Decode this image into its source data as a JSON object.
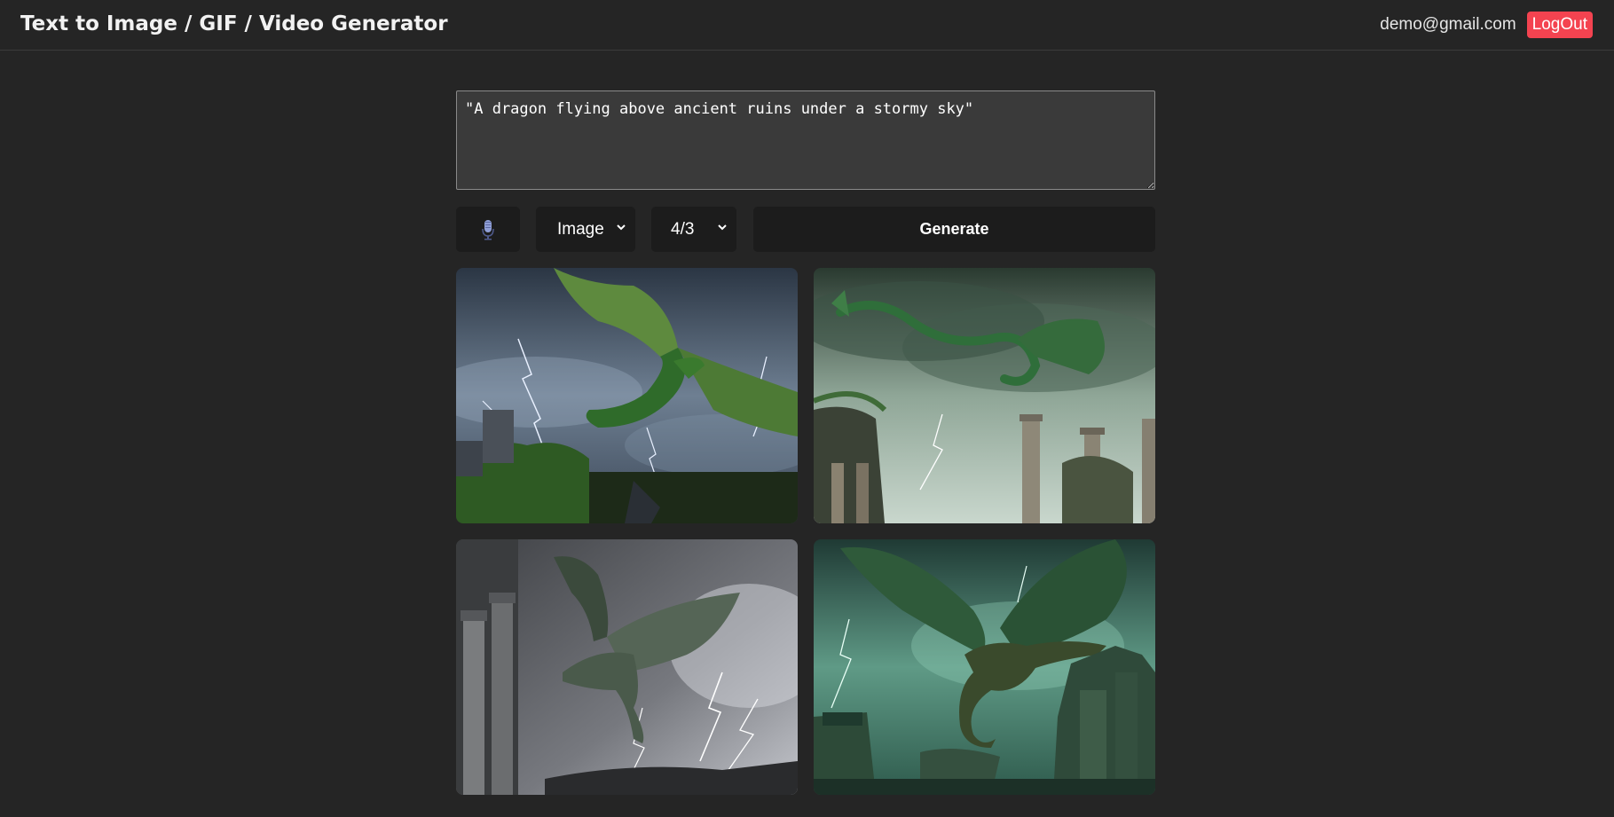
{
  "header": {
    "title": "Text to Image / GIF / Video Generator",
    "user_email": "demo@gmail.com",
    "logout_label": "LogOut"
  },
  "prompt": {
    "value": "\"A dragon flying above ancient ruins under a stormy sky\""
  },
  "controls": {
    "mic_icon": "microphone-icon",
    "media_type": "Image",
    "aspect_ratio": "4/3",
    "generate_label": "Generate"
  },
  "colors": {
    "background": "#252525",
    "control_bg": "#1c1c1c",
    "logout": "#f44350",
    "prompt_bg": "#3a3a3a"
  },
  "gallery": {
    "count": 4
  }
}
